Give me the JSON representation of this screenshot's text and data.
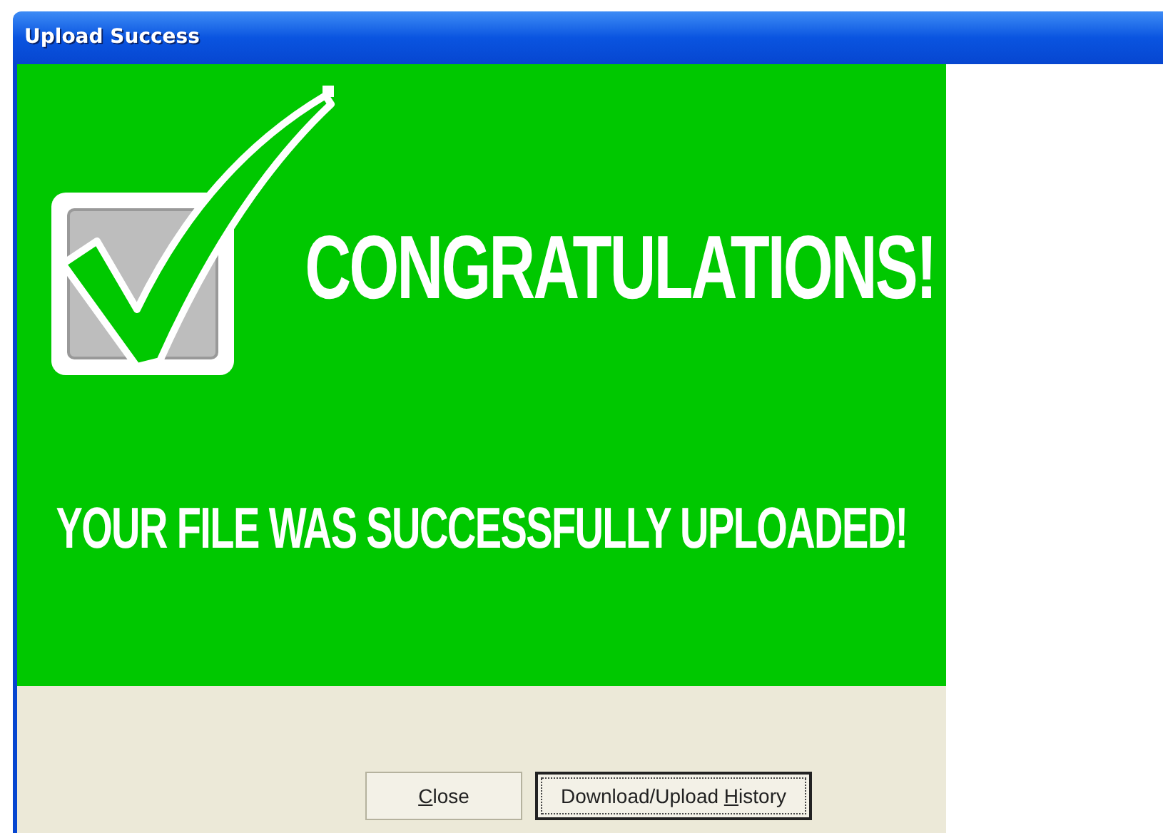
{
  "window": {
    "title": "Upload Success"
  },
  "banner": {
    "heading": "CONGRATULATIONS!",
    "message": "YOUR FILE WAS SUCCESSFULLY UPLOADED!"
  },
  "buttons": [
    {
      "access_key": "C",
      "after": "lose",
      "focused": false
    },
    {
      "before": "Download/Upload ",
      "access_key": "H",
      "after": "istory",
      "focused": true
    }
  ]
}
